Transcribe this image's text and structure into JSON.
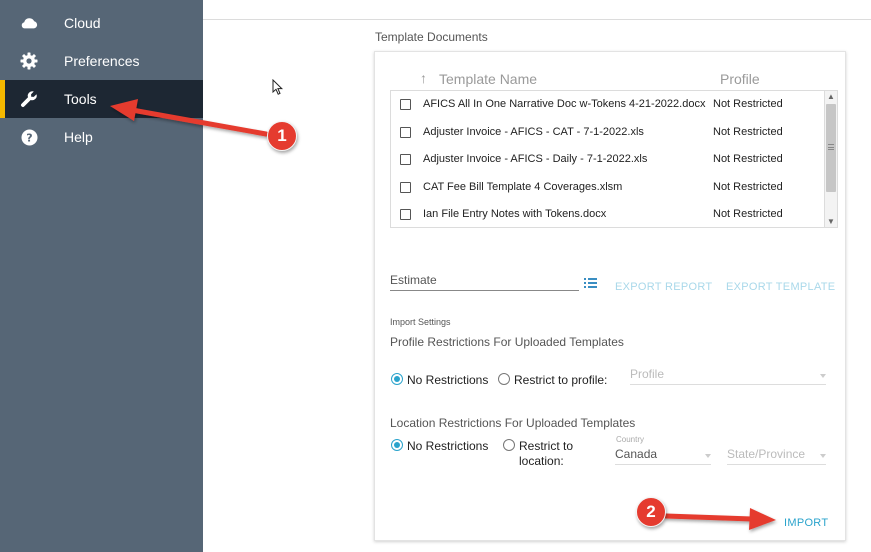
{
  "sidebar": {
    "items": [
      {
        "label": "Cloud",
        "icon": "cloud-icon",
        "active": false
      },
      {
        "label": "Preferences",
        "icon": "gear-icon",
        "active": false
      },
      {
        "label": "Tools",
        "icon": "wrench-icon",
        "active": true
      },
      {
        "label": "Help",
        "icon": "help-icon",
        "active": false
      }
    ],
    "accent_color": "#f5b800",
    "background": "#566676"
  },
  "main": {
    "section_title": "Template Documents",
    "table": {
      "columns": [
        "Template Name",
        "Profile"
      ],
      "sort_indicator": "↑",
      "rows": [
        {
          "name": "AFICS All In One Narrative Doc w-Tokens 4-21-2022.docx",
          "profile": "Not Restricted",
          "checked": false
        },
        {
          "name": "Adjuster Invoice - AFICS - CAT - 7-1-2022.xls",
          "profile": "Not Restricted",
          "checked": false
        },
        {
          "name": "Adjuster Invoice - AFICS - Daily - 7-1-2022.xls",
          "profile": "Not Restricted",
          "checked": false
        },
        {
          "name": "CAT Fee Bill Template 4 Coverages.xlsm",
          "profile": "Not Restricted",
          "checked": false
        },
        {
          "name": "Ian File Entry Notes with Tokens.docx",
          "profile": "Not Restricted",
          "checked": false
        }
      ]
    },
    "estimate_field": {
      "value": "Estimate"
    },
    "export_report_label": "EXPORT REPORT",
    "export_template_label": "EXPORT TEMPLATE",
    "import_settings_label": "Import Settings",
    "profile_restrictions": {
      "heading": "Profile Restrictions For Uploaded Templates",
      "option_none": "No Restrictions",
      "option_restrict": "Restrict to profile:",
      "selected": "none",
      "profile_select_placeholder": "Profile"
    },
    "location_restrictions": {
      "heading": "Location Restrictions For Uploaded Templates",
      "option_none": "No Restrictions",
      "option_restrict_line1": "Restrict to",
      "option_restrict_line2": "location:",
      "selected": "none",
      "country_label": "Country",
      "country_value": "Canada",
      "state_placeholder": "State/Province"
    },
    "import_label": "IMPORT",
    "accent_color": "#2aa3cc"
  },
  "annotations": [
    {
      "number": "1"
    },
    {
      "number": "2"
    }
  ]
}
